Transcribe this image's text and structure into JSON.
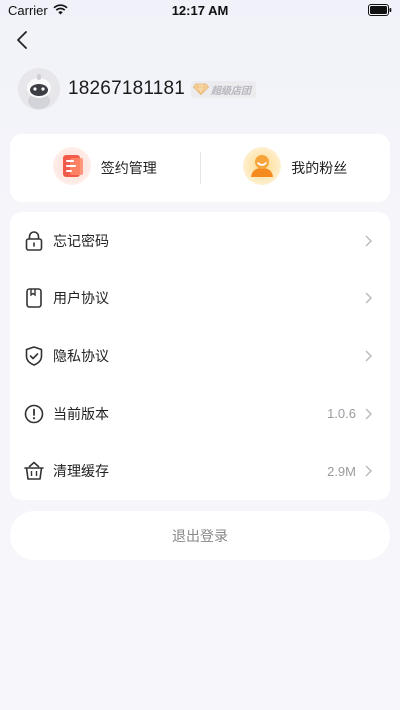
{
  "status_bar": {
    "carrier": "Carrier",
    "time": "12:17 AM"
  },
  "profile": {
    "phone": "18267181181",
    "badge": "超级店团"
  },
  "quick_actions": [
    {
      "label": "签约管理",
      "icon": "contract-icon"
    },
    {
      "label": "我的粉丝",
      "icon": "fans-icon"
    }
  ],
  "menu": [
    {
      "label": "忘记密码",
      "value": "",
      "icon": "lock-icon"
    },
    {
      "label": "用户协议",
      "value": "",
      "icon": "document-icon"
    },
    {
      "label": "隐私协议",
      "value": "",
      "icon": "shield-icon"
    },
    {
      "label": "当前版本",
      "value": "1.0.6",
      "icon": "info-icon"
    },
    {
      "label": "清理缓存",
      "value": "2.9M",
      "icon": "basket-icon"
    }
  ],
  "logout_label": "退出登录",
  "colors": {
    "accent_red": "#f25a4a",
    "accent_orange": "#f5a623",
    "background": "#f5f5fa"
  }
}
